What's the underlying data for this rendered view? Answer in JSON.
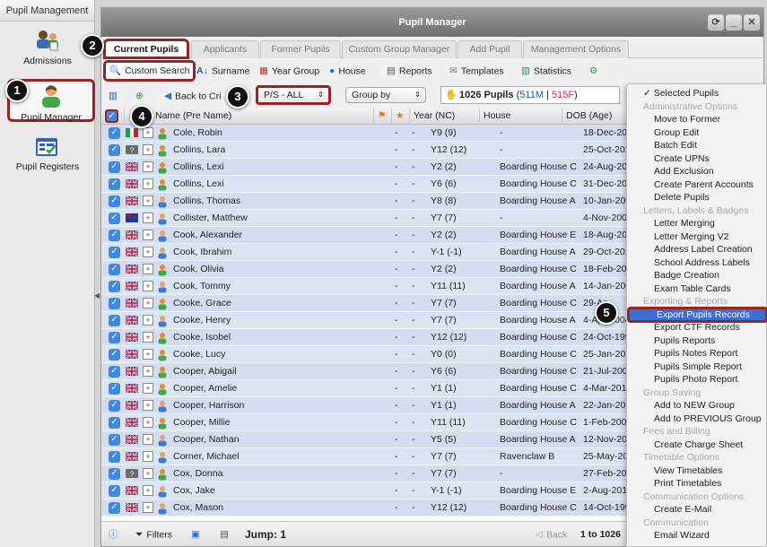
{
  "left_nav": {
    "header": "Pupil Management",
    "items": [
      {
        "label": "Admissions",
        "icon": "admissions-icon"
      },
      {
        "label": "Pupil Manager",
        "icon": "pupil-manager-icon"
      },
      {
        "label": "Pupil Registers",
        "icon": "pupil-registers-icon"
      }
    ]
  },
  "window": {
    "title": "Pupil Manager",
    "controls": [
      "refresh-icon",
      "minimize-icon",
      "close-icon"
    ]
  },
  "tabs": [
    "Current Pupils",
    "Applicants",
    "Former Pupils",
    "Custom Group Manager",
    "Add Pupil",
    "Management Options"
  ],
  "toolbar": [
    "Custom Search",
    "Surname",
    "Year Group",
    "House",
    "Reports",
    "Templates",
    "Statistics"
  ],
  "toolbar2": {
    "back": "Back to Cri",
    "filter_value": "P/S - ALL",
    "group_by": "Group by",
    "pupil_count": "1026 Pupils",
    "count_m": "511M",
    "count_f": "515F"
  },
  "grid": {
    "columns": [
      "Name (Pre Name)",
      "Year (NC)",
      "House",
      "DOB (Age)"
    ],
    "rows": [
      {
        "name": "Cole, Robin",
        "c1": "-",
        "c2": "-",
        "year": "Y9 (9)",
        "house": "-",
        "dob": "18-Dec-200",
        "flag": "it",
        "gender": "f"
      },
      {
        "name": "Collins, Lara",
        "c1": "-",
        "c2": "-",
        "year": "Y12 (12)",
        "house": "-",
        "dob": "25-Oct-201",
        "flag": "q",
        "gender": "f"
      },
      {
        "name": "Collins, Lexi",
        "c1": "-",
        "c2": "-",
        "year": "Y2 (2)",
        "house": "Boarding House C",
        "dob": "24-Aug-200",
        "flag": "uk",
        "gender": "f"
      },
      {
        "name": "Collins, Lexi",
        "c1": "-",
        "c2": "-",
        "year": "Y6 (6)",
        "house": "Boarding House C",
        "dob": "31-Dec-200",
        "flag": "uk",
        "gender": "f"
      },
      {
        "name": "Collins, Thomas",
        "c1": "-",
        "c2": "-",
        "year": "Y8 (8)",
        "house": "Boarding House A",
        "dob": "10-Jan-200",
        "flag": "uk",
        "gender": "m"
      },
      {
        "name": "Collister, Matthew",
        "c1": "-",
        "c2": "-",
        "year": "Y7 (7)",
        "house": "-",
        "dob": "4-Nov-2002",
        "flag": "nz",
        "gender": "m"
      },
      {
        "name": "Cook, Alexander",
        "c1": "-",
        "c2": "-",
        "year": "Y2 (2)",
        "house": "Boarding House E",
        "dob": "18-Aug-200",
        "flag": "uk",
        "gender": "m"
      },
      {
        "name": "Cook, Ibrahim",
        "c1": "-",
        "c2": "-",
        "year": "Y-1 (-1)",
        "house": "Boarding House A",
        "dob": "29-Oct-201",
        "flag": "uk",
        "gender": "m"
      },
      {
        "name": "Cook, Olivia",
        "c1": "-",
        "c2": "-",
        "year": "Y2 (2)",
        "house": "Boarding House C",
        "dob": "18-Feb-200",
        "flag": "uk",
        "gender": "f"
      },
      {
        "name": "Cook, Tommy",
        "c1": "-",
        "c2": "-",
        "year": "Y11 (11)",
        "house": "Boarding House A",
        "dob": "14-Jan-200",
        "flag": "uk",
        "gender": "m"
      },
      {
        "name": "Cooke, Grace",
        "c1": "-",
        "c2": "-",
        "year": "Y7 (7)",
        "house": "Boarding House C",
        "dob": "29-Ap",
        "flag": "uk",
        "gender": "f"
      },
      {
        "name": "Cooke, Henry",
        "c1": "-",
        "c2": "-",
        "year": "Y7 (7)",
        "house": "Boarding House A",
        "dob": "4-Apr-2004",
        "flag": "uk",
        "gender": "m"
      },
      {
        "name": "Cooke, Isobel",
        "c1": "-",
        "c2": "-",
        "year": "Y12 (12)",
        "house": "Boarding House C",
        "dob": "24-Oct-199",
        "flag": "uk",
        "gender": "f"
      },
      {
        "name": "Cooke, Lucy",
        "c1": "-",
        "c2": "-",
        "year": "Y0 (0)",
        "house": "Boarding House C",
        "dob": "25-Jan-201",
        "flag": "uk",
        "gender": "f"
      },
      {
        "name": "Cooper, Abigail",
        "c1": "-",
        "c2": "-",
        "year": "Y6 (6)",
        "house": "Boarding House C",
        "dob": "21-Jul-2005",
        "flag": "uk",
        "gender": "f"
      },
      {
        "name": "Cooper, Amelie",
        "c1": "-",
        "c2": "-",
        "year": "Y1 (1)",
        "house": "Boarding House C",
        "dob": "4-Mar-2010",
        "flag": "uk",
        "gender": "f"
      },
      {
        "name": "Cooper, Harrison",
        "c1": "-",
        "c2": "-",
        "year": "Y1 (1)",
        "house": "Boarding House A",
        "dob": "22-Jan-201",
        "flag": "uk",
        "gender": "m"
      },
      {
        "name": "Cooper, Millie",
        "c1": "-",
        "c2": "-",
        "year": "Y11 (11)",
        "house": "Boarding House C",
        "dob": "1-Feb-2000",
        "flag": "uk",
        "gender": "f"
      },
      {
        "name": "Cooper, Nathan",
        "c1": "-",
        "c2": "-",
        "year": "Y5 (5)",
        "house": "Boarding House A",
        "dob": "12-Nov-200",
        "flag": "uk",
        "gender": "m"
      },
      {
        "name": "Corner, Michael",
        "c1": "-",
        "c2": "-",
        "year": "Y7 (7)",
        "house": "Ravenclaw B",
        "dob": "25-May-200",
        "flag": "uk",
        "gender": "m"
      },
      {
        "name": "Cox, Donna",
        "c1": "-",
        "c2": "-",
        "year": "Y7 (7)",
        "house": "-",
        "dob": "27-Feb-200",
        "flag": "q",
        "gender": "f"
      },
      {
        "name": "Cox, Jake",
        "c1": "-",
        "c2": "-",
        "year": "Y-1 (-1)",
        "house": "Boarding House E",
        "dob": "2-Aug-2012",
        "flag": "uk",
        "gender": "m"
      },
      {
        "name": "Cox, Mason",
        "c1": "-",
        "c2": "-",
        "year": "Y12 (12)",
        "house": "Boarding House C",
        "dob": "14-Oct-199",
        "flag": "uk",
        "gender": "m"
      }
    ]
  },
  "statusbar": {
    "filters": "Filters",
    "jump": "Jump: 1",
    "back": "Back",
    "range": "1 to 1026"
  },
  "menu": [
    {
      "label": "Selected Pupils",
      "type": "checked"
    },
    {
      "label": "Administrative Options",
      "type": "section"
    },
    {
      "label": "Move to Former",
      "type": "item"
    },
    {
      "label": "Group Edit",
      "type": "item"
    },
    {
      "label": "Batch Edit",
      "type": "item"
    },
    {
      "label": "Create UPNs",
      "type": "item"
    },
    {
      "label": "Add Exclusion",
      "type": "item"
    },
    {
      "label": "Create Parent Accounts",
      "type": "item"
    },
    {
      "label": "Delete Pupils",
      "type": "item"
    },
    {
      "label": "Letters, Labels & Badges",
      "type": "section"
    },
    {
      "label": "Letter Merging",
      "type": "item"
    },
    {
      "label": "Letter Merging V2",
      "type": "item"
    },
    {
      "label": "Address Label Creation",
      "type": "item"
    },
    {
      "label": "School Address Labels",
      "type": "item"
    },
    {
      "label": "Badge Creation",
      "type": "item"
    },
    {
      "label": "Exam Table Cards",
      "type": "item"
    },
    {
      "label": "Exporting & Reports",
      "type": "section"
    },
    {
      "label": "Export Pupils Records",
      "type": "highlight"
    },
    {
      "label": "Export CTF Records",
      "type": "item"
    },
    {
      "label": "Pupils Reports",
      "type": "item"
    },
    {
      "label": "Pupils Notes Report",
      "type": "item"
    },
    {
      "label": "Pupils Simple Report",
      "type": "item"
    },
    {
      "label": "Pupils Photo Report",
      "type": "item"
    },
    {
      "label": "Group Saving",
      "type": "section"
    },
    {
      "label": "Add to NEW Group",
      "type": "item"
    },
    {
      "label": "Add to PREVIOUS Group",
      "type": "item"
    },
    {
      "label": "Fees and Billing",
      "type": "section"
    },
    {
      "label": "Create Charge Sheet",
      "type": "item"
    },
    {
      "label": "Timetable Options",
      "type": "section"
    },
    {
      "label": "View Timetables",
      "type": "item"
    },
    {
      "label": "Print Timetables",
      "type": "item"
    },
    {
      "label": "Communication Options",
      "type": "section"
    },
    {
      "label": "Create E-Mail",
      "type": "item"
    },
    {
      "label": "Communication",
      "type": "section"
    },
    {
      "label": "Email Wizard",
      "type": "item"
    }
  ],
  "callouts": [
    "1",
    "2",
    "3",
    "4",
    "5"
  ],
  "colors": {
    "accent": "#9b2323",
    "selection": "#3a6fd4",
    "row": "#dbe4f3"
  }
}
